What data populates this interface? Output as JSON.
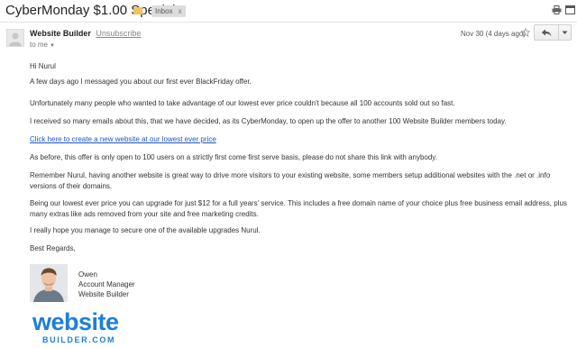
{
  "email": {
    "subject": "CyberMonday $1.00 Special",
    "label": "Inbox",
    "label_close": "x",
    "sender": {
      "name": "Website Builder",
      "unsubscribe": "Unsubscribe"
    },
    "recipient": "to me",
    "date": "Nov 30 (4 days ago)",
    "body": {
      "greeting": "Hi Nurul",
      "p1": "A few days ago I messaged you about our first ever BlackFriday offer.",
      "p2": "Unfortunately many people who wanted to take advantage of our lowest ever price couldn't because all 100 accounts sold out so fast.",
      "p3": "I received so many emails about this, that we have decided, as its CyberMonday, to open up the offer to another 100 Website Builder members today.",
      "link": "Click here to create a new website at our lowest ever price",
      "p4": "As before, this offer is only open to 100 users on a strictly first come first serve basis, please do not share this link with anybody.",
      "p5": "Remember Nurul, having another website is great way to drive more visitors to your existing website, some members setup additional websites with the .net or .info versions of their domains.",
      "p6": "Being our lowest ever price you can upgrade for just $12 for a full years' service. This includes a free domain name of your choice plus free business email address, plus many extras like ads removed from your site and free marketing credits.",
      "p7": "I really hope you manage to secure one of the available upgrades Nurul.",
      "closing": "Best Regards,"
    },
    "signature": {
      "name": "Owen",
      "title": "Account Manager",
      "company": "Website Builder"
    },
    "logo": {
      "word": "website",
      "sub": "BUILDER.COM"
    }
  },
  "icons": {
    "label": "label-tag-icon",
    "print": "print-icon",
    "new_window": "new-window-icon",
    "star": "star-icon",
    "reply": "reply-icon",
    "more": "chevron-down-icon"
  },
  "colors": {
    "link": "#1a55c9",
    "label_tag": "#f3c35a",
    "brand": "#1e7fd6"
  }
}
